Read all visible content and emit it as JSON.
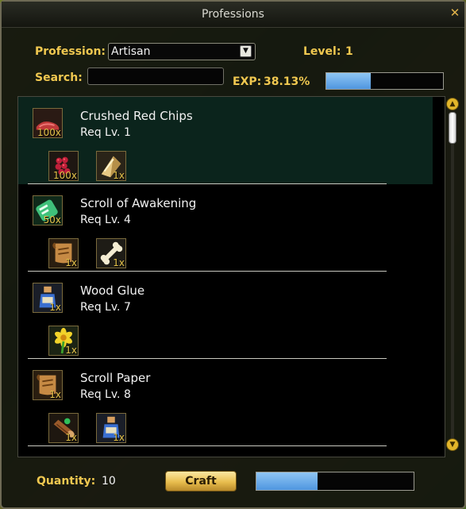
{
  "window": {
    "title": "Professions"
  },
  "profession": {
    "label": "Profession:",
    "selected": "Artisan"
  },
  "level": {
    "label": "Level:",
    "value": "1"
  },
  "search": {
    "label": "Search:",
    "value": ""
  },
  "exp": {
    "label": "EXP:",
    "value": "38.13%",
    "fraction": 0.3813
  },
  "recipes": [
    {
      "name": "Crushed Red Chips",
      "req": "Req Lv. 1",
      "qty": "100x",
      "icon": "red-chips-icon",
      "selected": true,
      "ingredients": [
        {
          "qty": "100x",
          "icon": "red-berries-icon"
        },
        {
          "qty": "1x",
          "icon": "crystal-shard-icon"
        }
      ]
    },
    {
      "name": "Scroll of Awakening",
      "req": "Req Lv. 4",
      "qty": "50x",
      "icon": "green-scroll-icon",
      "selected": false,
      "ingredients": [
        {
          "qty": "1x",
          "icon": "scroll-paper-icon"
        },
        {
          "qty": "1x",
          "icon": "bone-icon"
        }
      ]
    },
    {
      "name": "Wood Glue",
      "req": "Req Lv. 7",
      "qty": "1x",
      "icon": "glue-bottle-icon",
      "selected": false,
      "ingredients": [
        {
          "qty": "1x",
          "icon": "yellow-flower-icon"
        }
      ]
    },
    {
      "name": "Scroll Paper",
      "req": "Req Lv. 8",
      "qty": "1x",
      "icon": "scroll-paper-icon",
      "selected": false,
      "ingredients": [
        {
          "qty": "1x",
          "icon": "wood-log-icon"
        },
        {
          "qty": "1x",
          "icon": "glue-bottle-icon"
        }
      ]
    }
  ],
  "quantity": {
    "label": "Quantity:",
    "value": "10"
  },
  "craft": {
    "label": "Craft",
    "progress": 0.39
  },
  "colors": {
    "accent_gold": "#f0c850",
    "exp_bar": "#6fb0ee",
    "selected_row": "#0b241c"
  }
}
